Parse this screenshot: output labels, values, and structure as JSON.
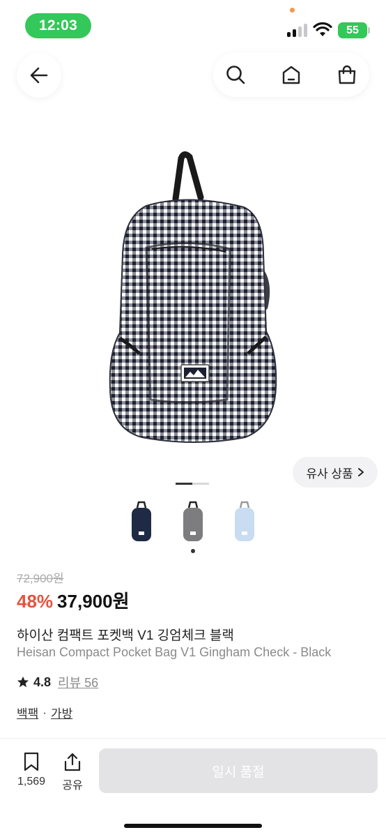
{
  "status_bar": {
    "time": "12:03",
    "battery": "55"
  },
  "nav": {
    "back_icon": "arrow-left-icon",
    "search_icon": "search-icon",
    "home_icon": "home-icon",
    "bag_icon": "shopping-bag-icon"
  },
  "gallery": {
    "similar_label": "유사 상품",
    "current_page": 1,
    "total_pages": 2,
    "thumbnails": [
      {
        "color": "#1f2a44"
      },
      {
        "color": "#7d7d80"
      },
      {
        "color": "#c8dcf2"
      }
    ],
    "selected_thumb": 2
  },
  "product": {
    "original_price": "72,900원",
    "discount": "48%",
    "price": "37,900원",
    "title_ko": "하이산 컴팩트 포켓백 V1 깅엄체크 블랙",
    "title_en": "Heisan Compact Pocket Bag V1 Gingham Check - Black",
    "rating": "4.8",
    "review_link": "리뷰 56",
    "category_1": "백팩",
    "category_separator": "·",
    "category_2": "가방"
  },
  "bottom_bar": {
    "bookmark_count": "1,569",
    "share_label": "공유",
    "soldout_label": "일시 품절"
  },
  "colors": {
    "accent_discount": "#e5533f",
    "status_green": "#34c759"
  }
}
